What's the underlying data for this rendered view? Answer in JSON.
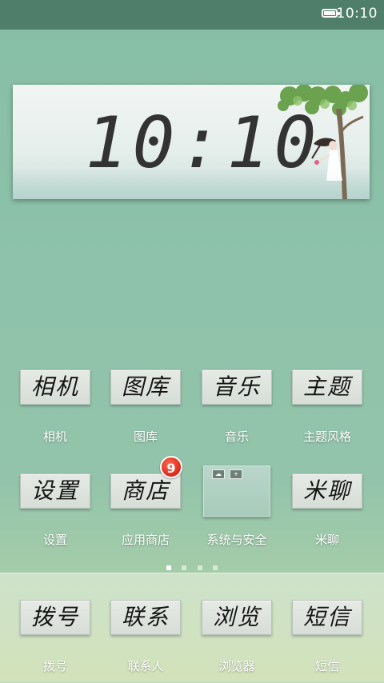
{
  "status_bar": {
    "time": "10:10",
    "battery_icon": "battery-full-icon"
  },
  "widget": {
    "clock_time": "10:10"
  },
  "apps": [
    {
      "name": "camera",
      "icon_text": "相机",
      "label": "相机"
    },
    {
      "name": "gallery",
      "icon_text": "图库",
      "label": "图库"
    },
    {
      "name": "music",
      "icon_text": "音乐",
      "label": "音乐"
    },
    {
      "name": "themes",
      "icon_text": "主题",
      "label": "主题风格"
    },
    {
      "name": "settings",
      "icon_text": "设置",
      "label": "设置"
    },
    {
      "name": "app-store",
      "icon_text": "商店",
      "label": "应用商店",
      "badge": "9"
    },
    {
      "name": "system-security",
      "label": "系统与安全"
    },
    {
      "name": "miliao",
      "icon_text": "米聊",
      "label": "米聊"
    }
  ],
  "dock": [
    {
      "name": "dialer",
      "icon_text": "拨号",
      "label": "拨号"
    },
    {
      "name": "contacts",
      "icon_text": "联系",
      "label": "联系人"
    },
    {
      "name": "browser",
      "icon_text": "浏览",
      "label": "浏览器"
    },
    {
      "name": "messages",
      "icon_text": "短信",
      "label": "短信"
    }
  ],
  "page_indicator": {
    "total": 4,
    "current": 1
  },
  "colors": {
    "status_bar": "#4f7f6b",
    "wallpaper": "#8ec2aa",
    "badge": "#e0311f"
  }
}
